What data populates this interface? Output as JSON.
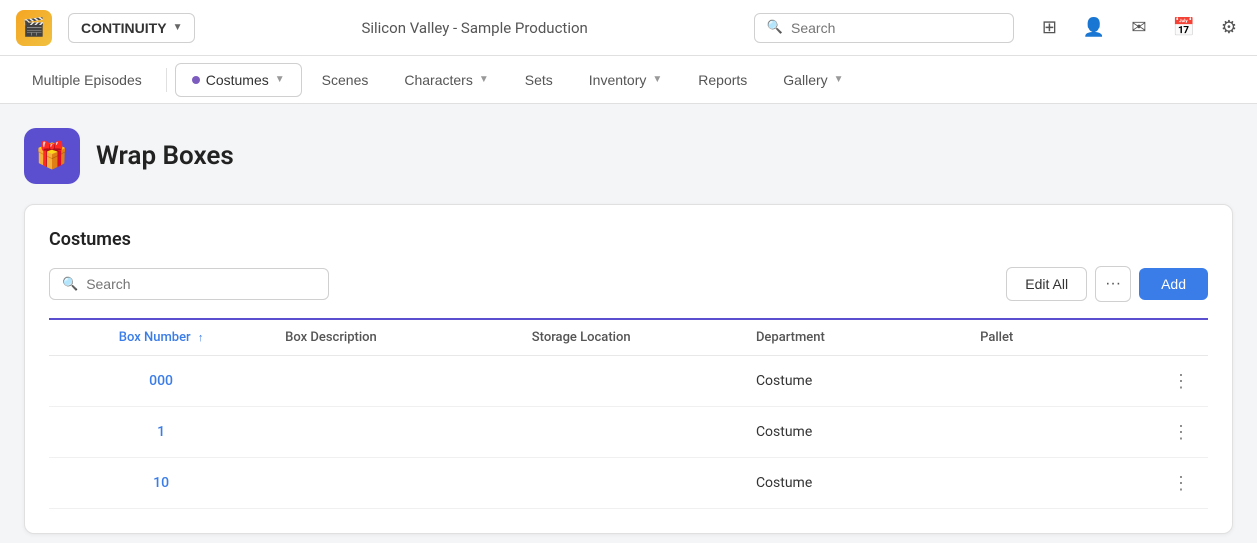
{
  "app": {
    "logo_emoji": "🎬",
    "continuity_label": "CONTINUITY"
  },
  "header": {
    "production_title": "Silicon Valley - Sample Production",
    "search_placeholder": "Search"
  },
  "top_icons": [
    {
      "name": "grid-icon",
      "symbol": "⊞"
    },
    {
      "name": "user-icon",
      "symbol": "👤"
    },
    {
      "name": "mail-icon",
      "symbol": "✉"
    },
    {
      "name": "calendar-icon",
      "symbol": "📅"
    },
    {
      "name": "settings-icon",
      "symbol": "⚙"
    }
  ],
  "sub_nav": {
    "items": [
      {
        "id": "multiple-episodes",
        "label": "Multiple Episodes",
        "active": false,
        "has_dot": false
      },
      {
        "id": "costumes",
        "label": "Costumes",
        "active": true,
        "has_dot": true
      },
      {
        "id": "scenes",
        "label": "Scenes",
        "active": false,
        "has_dot": false
      },
      {
        "id": "characters",
        "label": "Characters",
        "active": false,
        "has_dot": false,
        "has_chevron": true
      },
      {
        "id": "sets",
        "label": "Sets",
        "active": false,
        "has_dot": false
      },
      {
        "id": "inventory",
        "label": "Inventory",
        "active": false,
        "has_dot": false,
        "has_chevron": true
      },
      {
        "id": "reports",
        "label": "Reports",
        "active": false,
        "has_dot": false
      },
      {
        "id": "gallery",
        "label": "Gallery",
        "active": false,
        "has_dot": false,
        "has_chevron": true
      }
    ]
  },
  "page": {
    "icon_emoji": "🎁",
    "title": "Wrap Boxes"
  },
  "costumes_section": {
    "title": "Costumes",
    "search_placeholder": "Search",
    "edit_all_label": "Edit All",
    "more_label": "···",
    "add_label": "Add"
  },
  "table": {
    "columns": [
      {
        "id": "box_number",
        "label": "Box Number",
        "sorted": true,
        "sort_dir": "↑"
      },
      {
        "id": "box_description",
        "label": "Box Description"
      },
      {
        "id": "storage_location",
        "label": "Storage Location"
      },
      {
        "id": "department",
        "label": "Department"
      },
      {
        "id": "pallet",
        "label": "Pallet"
      }
    ],
    "rows": [
      {
        "box_number": "000",
        "box_description": "",
        "storage_location": "",
        "department": "Costume",
        "pallet": ""
      },
      {
        "box_number": "1",
        "box_description": "",
        "storage_location": "",
        "department": "Costume",
        "pallet": ""
      },
      {
        "box_number": "10",
        "box_description": "",
        "storage_location": "",
        "department": "Costume",
        "pallet": ""
      }
    ]
  }
}
